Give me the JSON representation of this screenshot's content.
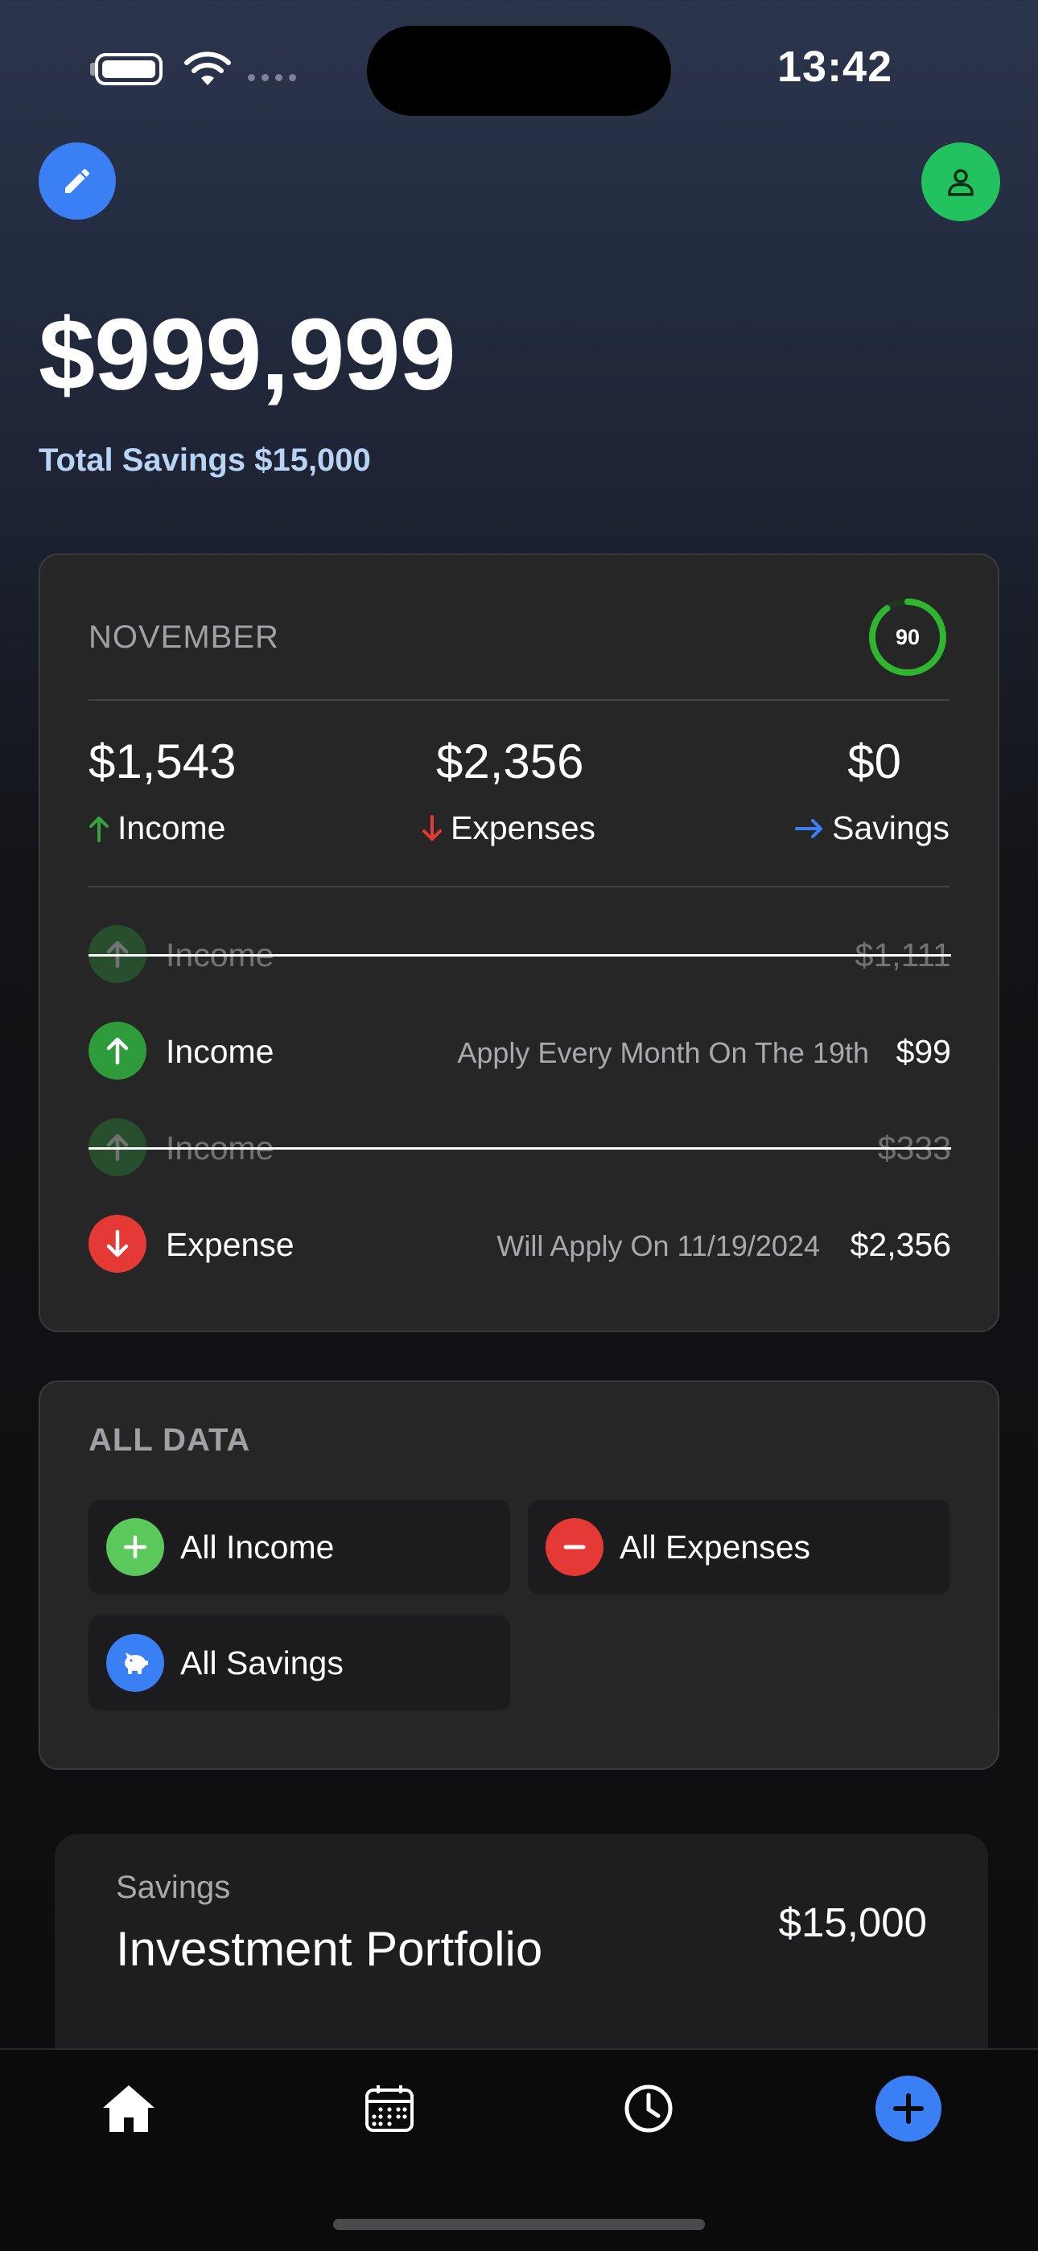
{
  "status_bar": {
    "time": "13:42"
  },
  "header": {
    "balance": "$999,999",
    "savings_label": "Total Savings $15,000",
    "edit_icon": "pencil-icon",
    "profile_icon": "person-icon"
  },
  "month_card": {
    "title": "NOVEMBER",
    "progress_value": "90",
    "progress_fraction": 0.9,
    "stats": [
      {
        "value": "$1,543",
        "label": "Income"
      },
      {
        "value": "$2,356",
        "label": "Expenses"
      },
      {
        "value": "$0",
        "label": "Savings"
      }
    ],
    "transactions": [
      {
        "label": "Income",
        "note": "",
        "amount": "$1,111",
        "struck": true
      },
      {
        "label": "Income",
        "note": "Apply Every Month On The 19th",
        "amount": "$99",
        "struck": false
      },
      {
        "label": "Income",
        "note": "",
        "amount": "$333",
        "struck": true
      },
      {
        "label": "Expense",
        "note": "Will Apply On 11/19/2024",
        "amount": "$2,356",
        "struck": false
      }
    ]
  },
  "all_data": {
    "title": "ALL DATA",
    "items": [
      {
        "label": "All Income",
        "icon": "plus-icon"
      },
      {
        "label": "All Expenses",
        "icon": "minus-icon"
      },
      {
        "label": "All Savings",
        "icon": "piggy-bank-icon"
      }
    ]
  },
  "portfolio": {
    "category": "Savings",
    "name": "Investment Portfolio",
    "amount": "$15,000"
  },
  "tab_bar": {
    "tabs": [
      "home-icon",
      "calendar-icon",
      "clock-icon",
      "add-icon"
    ]
  },
  "colors": {
    "accent_blue": "#3b7ff5",
    "income_green": "#2e9c3a",
    "expense_red": "#e53935",
    "profile_green": "#22c35e"
  }
}
